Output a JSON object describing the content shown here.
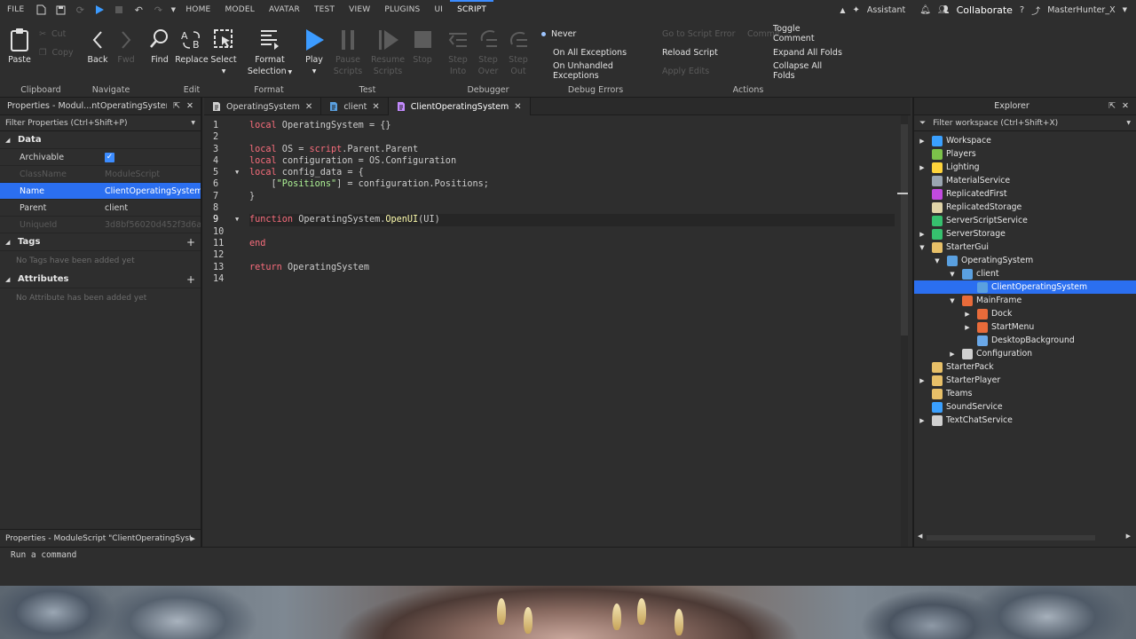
{
  "menubar": {
    "file": "FILE",
    "tabs": [
      "HOME",
      "MODEL",
      "AVATAR",
      "TEST",
      "VIEW",
      "PLUGINS",
      "UI",
      "SCRIPT"
    ],
    "assistant": "Assistant",
    "collaborate": "Collaborate",
    "username": "MasterHunter_X"
  },
  "ribbon": {
    "clipboard": {
      "label": "Clipboard",
      "paste": "Paste",
      "cut": "Cut",
      "copy": "Copy"
    },
    "navigate": {
      "label": "Navigate",
      "back": "Back",
      "fwd": "Fwd"
    },
    "edit": {
      "label": "Edit",
      "find": "Find",
      "replace": "Replace",
      "select": "Select"
    },
    "format": {
      "label": "Format",
      "format_selection_1": "Format",
      "format_selection_2": "Selection"
    },
    "test": {
      "label": "Test",
      "play": "Play",
      "pause_1": "Pause",
      "pause_2": "Scripts",
      "resume_1": "Resume",
      "resume_2": "Scripts",
      "stop": "Stop"
    },
    "debugger": {
      "label": "Debugger",
      "step_into_1": "Step",
      "step_into_2": "Into",
      "step_over_1": "Step",
      "step_over_2": "Over",
      "step_out_1": "Step",
      "step_out_2": "Out"
    },
    "debug_errors": {
      "label": "Debug Errors",
      "never": "Never",
      "all": "On All Exceptions",
      "unhandled": "On Unhandled Exceptions"
    },
    "actions": {
      "label": "Actions",
      "go_to_error": "Go to Script Error",
      "commit": "Commit",
      "reload": "Reload Script",
      "apply_edits": "Apply Edits",
      "toggle_comment": "Toggle Comment",
      "expand": "Expand All Folds",
      "collapse": "Collapse All Folds"
    }
  },
  "properties": {
    "title": "Properties - Modul...ntOperatingSystem\"",
    "filter": "Filter Properties (Ctrl+Shift+P)",
    "data_section": "Data",
    "rows": [
      {
        "key": "Archivable",
        "value": ""
      },
      {
        "key": "ClassName",
        "value": "ModuleScript"
      },
      {
        "key": "Name",
        "value": "ClientOperatingSystem"
      },
      {
        "key": "Parent",
        "value": "client"
      },
      {
        "key": "UniqueId",
        "value": "3d8bf56020d452f3d6a..."
      }
    ],
    "tags_section": "Tags",
    "tags_empty": "No Tags have been added yet",
    "attributes_section": "Attributes",
    "attributes_empty": "No Attribute has been added yet",
    "footer": "Properties - ModuleScript \"ClientOperatingSyst"
  },
  "editor": {
    "tabs": [
      "OperatingSystem",
      "client",
      "ClientOperatingSystem"
    ],
    "line_numbers": [
      "1",
      "2",
      "3",
      "4",
      "5",
      "6",
      "7",
      "8",
      "9",
      "10",
      "11",
      "12",
      "13",
      "14"
    ],
    "code": {
      "l1_kw": "local",
      "l1_rest": " OperatingSystem = {}",
      "l3_kw": "local",
      "l3_a": " OS = ",
      "l3_b": "script",
      "l3_c": ".Parent.Parent",
      "l4_kw": "local",
      "l4_rest": " configuration = OS.Configuration",
      "l5_kw": "local",
      "l5_rest": " config_data = {",
      "l6_a": "    [",
      "l6_str": "\"Positions\"",
      "l6_b": "] = configuration.Positions;",
      "l7": "}",
      "l9_kw": "function",
      "l9_a": " OperatingSystem.",
      "l9_fn": "OpenUI",
      "l9_b": "(UI)",
      "l11_kw": "end",
      "l13_kw": "return",
      "l13_rest": " OperatingSystem"
    }
  },
  "explorer": {
    "title": "Explorer",
    "filter": "Filter workspace (Ctrl+Shift+X)",
    "items": [
      {
        "label": "Workspace",
        "color": "#3aa0ff"
      },
      {
        "label": "Players",
        "color": "#7cc24a"
      },
      {
        "label": "Lighting",
        "color": "#ffd43b"
      },
      {
        "label": "MaterialService",
        "color": "#9aa5b1"
      },
      {
        "label": "ReplicatedFirst",
        "color": "#c24ae0"
      },
      {
        "label": "ReplicatedStorage",
        "color": "#e0d4a8"
      },
      {
        "label": "ServerScriptService",
        "color": "#36c06e"
      },
      {
        "label": "ServerStorage",
        "color": "#36c06e"
      },
      {
        "label": "StarterGui",
        "color": "#e8c068"
      },
      {
        "label": "OperatingSystem",
        "color": "#5aa0e0"
      },
      {
        "label": "client",
        "color": "#5aa0e0"
      },
      {
        "label": "ClientOperatingSystem",
        "color": "#5aa0e0"
      },
      {
        "label": "MainFrame",
        "color": "#e86b3a"
      },
      {
        "label": "Dock",
        "color": "#e86b3a"
      },
      {
        "label": "StartMenu",
        "color": "#e86b3a"
      },
      {
        "label": "DesktopBackground",
        "color": "#6aa8e8"
      },
      {
        "label": "Configuration",
        "color": "#d0d0d0"
      },
      {
        "label": "StarterPack",
        "color": "#e8c068"
      },
      {
        "label": "StarterPlayer",
        "color": "#e8c068"
      },
      {
        "label": "Teams",
        "color": "#e8c068"
      },
      {
        "label": "SoundService",
        "color": "#3aa0ff"
      },
      {
        "label": "TextChatService",
        "color": "#d0d0d0"
      }
    ]
  },
  "command": {
    "placeholder": "Run a command"
  }
}
